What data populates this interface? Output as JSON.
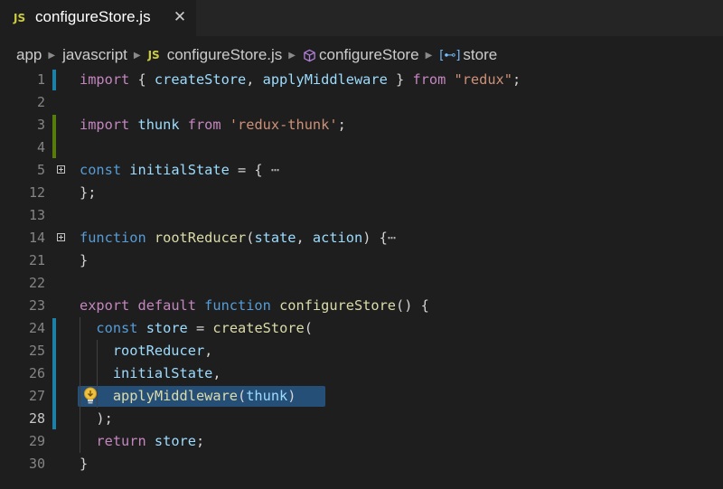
{
  "tab": {
    "icon_label": "JS",
    "title": "configureStore.js",
    "close_glyph": "✕",
    "icon": "js-file-icon"
  },
  "breadcrumb": {
    "items": [
      "app",
      "javascript",
      "configureStore.js",
      "configureStore",
      "store"
    ],
    "file_icon_label": "JS",
    "field_icon_label": "[⊷]",
    "icons": [
      "chevron-right-icon",
      "js-file-icon",
      "method-cube-icon",
      "field-icon"
    ]
  },
  "colors": {
    "background": "#1e1e1e",
    "keyword": "#c586c0",
    "storage": "#569cd6",
    "variable": "#9cdcfe",
    "function": "#dcdcaa",
    "string": "#ce9178",
    "modified_bar": "#1b81a8",
    "added_bar": "#587c0c",
    "selection": "#264f78",
    "lightbulb": "#f0c040"
  },
  "lines": [
    {
      "n": "1",
      "tokens": [
        [
          "kw",
          "import"
        ],
        [
          "pl",
          " { "
        ],
        [
          "var",
          "createStore"
        ],
        [
          "pl",
          ", "
        ],
        [
          "var",
          "applyMiddleware"
        ],
        [
          "pl",
          " } "
        ],
        [
          "kw",
          "from"
        ],
        [
          "pl",
          " "
        ],
        [
          "str",
          "\"redux\""
        ],
        [
          "pl",
          ";"
        ]
      ]
    },
    {
      "n": "2",
      "tokens": []
    },
    {
      "n": "3",
      "tokens": [
        [
          "kw",
          "import"
        ],
        [
          "pl",
          " "
        ],
        [
          "var",
          "thunk"
        ],
        [
          "pl",
          " "
        ],
        [
          "kw",
          "from"
        ],
        [
          "pl",
          " "
        ],
        [
          "str",
          "'redux-thunk'"
        ],
        [
          "pl",
          ";"
        ]
      ]
    },
    {
      "n": "4",
      "tokens": []
    },
    {
      "n": "5",
      "fold": true,
      "tokens": [
        [
          "kwb",
          "const"
        ],
        [
          "pl",
          " "
        ],
        [
          "var",
          "initialState"
        ],
        [
          "pl",
          " = { "
        ],
        [
          "dots",
          "⋯"
        ]
      ]
    },
    {
      "n": "12",
      "tokens": [
        [
          "pl",
          "};"
        ]
      ]
    },
    {
      "n": "13",
      "tokens": []
    },
    {
      "n": "14",
      "fold": true,
      "tokens": [
        [
          "kwb",
          "function"
        ],
        [
          "pl",
          " "
        ],
        [
          "fn",
          "rootReducer"
        ],
        [
          "pl",
          "("
        ],
        [
          "var",
          "state"
        ],
        [
          "pl",
          ", "
        ],
        [
          "var",
          "action"
        ],
        [
          "pl",
          ") {"
        ],
        [
          "dots",
          "⋯"
        ]
      ]
    },
    {
      "n": "21",
      "tokens": [
        [
          "pl",
          "}"
        ]
      ]
    },
    {
      "n": "22",
      "tokens": []
    },
    {
      "n": "23",
      "tokens": [
        [
          "kw",
          "export"
        ],
        [
          "pl",
          " "
        ],
        [
          "kw",
          "default"
        ],
        [
          "pl",
          " "
        ],
        [
          "kwb",
          "function"
        ],
        [
          "pl",
          " "
        ],
        [
          "fn",
          "configureStore"
        ],
        [
          "pl",
          "() {"
        ]
      ]
    },
    {
      "n": "24",
      "tokens": [
        [
          "pl",
          "  "
        ],
        [
          "kwb",
          "const"
        ],
        [
          "pl",
          " "
        ],
        [
          "var",
          "store"
        ],
        [
          "pl",
          " = "
        ],
        [
          "fn",
          "createStore"
        ],
        [
          "pl",
          "("
        ]
      ]
    },
    {
      "n": "25",
      "tokens": [
        [
          "pl",
          "    "
        ],
        [
          "var",
          "rootReducer"
        ],
        [
          "pl",
          ","
        ]
      ]
    },
    {
      "n": "26",
      "tokens": [
        [
          "pl",
          "    "
        ],
        [
          "var",
          "initialState"
        ],
        [
          "pl",
          ","
        ]
      ]
    },
    {
      "n": "27",
      "tokens": [
        [
          "pl",
          "    "
        ],
        [
          "fn",
          "applyMiddleware"
        ],
        [
          "pl",
          "("
        ],
        [
          "var",
          "thunk"
        ],
        [
          "pl",
          ")"
        ]
      ]
    },
    {
      "n": "28",
      "current": true,
      "tokens": [
        [
          "pl",
          "  );"
        ]
      ]
    },
    {
      "n": "29",
      "tokens": [
        [
          "pl",
          "  "
        ],
        [
          "kw",
          "return"
        ],
        [
          "pl",
          " "
        ],
        [
          "var",
          "store"
        ],
        [
          "pl",
          ";"
        ]
      ]
    },
    {
      "n": "30",
      "tokens": [
        [
          "pl",
          "}"
        ]
      ]
    }
  ],
  "gutter_markers": [
    {
      "type": "modified",
      "from_line": "1",
      "to_line": "1"
    },
    {
      "type": "added",
      "from_line": "3",
      "to_line": "4"
    },
    {
      "type": "modified",
      "from_line": "24",
      "to_line": "28"
    }
  ],
  "code_action": {
    "icon": "lightbulb-icon",
    "line": "27"
  }
}
